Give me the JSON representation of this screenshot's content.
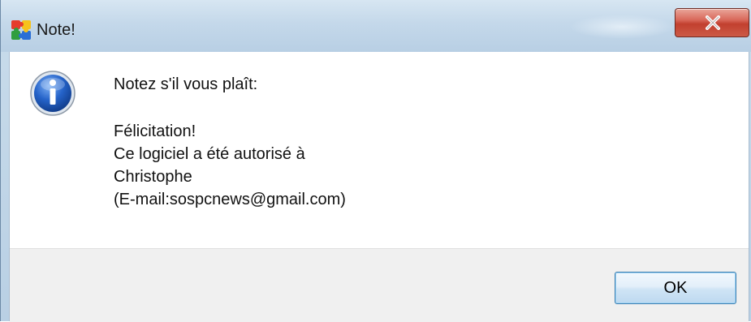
{
  "window": {
    "title": "Note!",
    "app_icon": "colorful-puzzle-icon",
    "close_icon": "close-x-icon"
  },
  "dialog": {
    "icon": "information-icon",
    "message_lines": [
      "Notez s'il vous plaît:",
      "",
      "Félicitation!",
      "Ce logiciel a été autorisé à",
      "Christophe",
      "(E-mail:sospcnews@gmail.com)"
    ]
  },
  "buttons": {
    "ok_label": "OK"
  },
  "colors": {
    "titlebar": "#c4d8ea",
    "close_button": "#c2402f",
    "ok_border": "#3c7fb1",
    "info_icon": "#1b56b8"
  }
}
